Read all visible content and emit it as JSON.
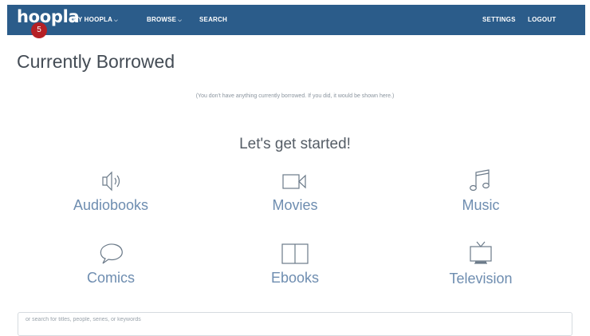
{
  "nav": {
    "logo": "hoopla",
    "badge": "5",
    "items": [
      {
        "label": "MY HOOPLA",
        "caret": "v"
      },
      {
        "label": "BROWSE",
        "caret": "v"
      },
      {
        "label": "SEARCH"
      }
    ],
    "right_items": [
      {
        "label": "SETTINGS"
      },
      {
        "label": "LOGOUT"
      }
    ]
  },
  "page": {
    "title": "Currently Borrowed",
    "empty_message": "(You don't have anything currently borrowed. If you did, it would be shown here.)",
    "get_started": "Let's get started!"
  },
  "categories": [
    {
      "label": "Audiobooks",
      "icon": "speaker-icon"
    },
    {
      "label": "Movies",
      "icon": "video-camera-icon"
    },
    {
      "label": "Music",
      "icon": "music-note-icon"
    },
    {
      "label": "Comics",
      "icon": "speech-bubble-icon"
    },
    {
      "label": "Ebooks",
      "icon": "open-book-icon"
    },
    {
      "label": "Television",
      "icon": "television-icon"
    }
  ],
  "search": {
    "placeholder": "or search for titles, people, series, or keywords",
    "value": ""
  },
  "colors": {
    "nav_background": "#2b5c8a",
    "badge": "#b52025",
    "category_text": "#6e8db0"
  }
}
